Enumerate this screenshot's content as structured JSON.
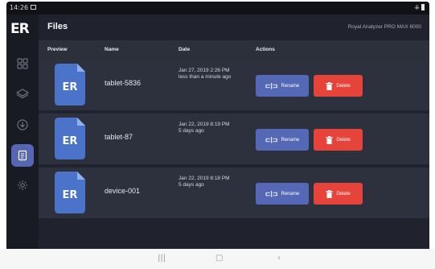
{
  "status_bar": {
    "time": "14:26",
    "icons": [
      "picture-icon",
      "signal-icon",
      "battery-icon"
    ]
  },
  "sidebar": {
    "logo": "ER",
    "items": [
      {
        "name": "dashboard",
        "icon": "grid-icon"
      },
      {
        "name": "layers",
        "icon": "layers-icon"
      },
      {
        "name": "download",
        "icon": "download-icon"
      },
      {
        "name": "files",
        "icon": "files-icon",
        "active": true
      },
      {
        "name": "settings",
        "icon": "gear-icon"
      }
    ]
  },
  "header": {
    "title": "Files",
    "app_name": "Royal Analyzer PRO MAX 6000"
  },
  "table": {
    "columns": [
      "Preview",
      "Name",
      "Date",
      "Actions"
    ],
    "rows": [
      {
        "name": "tablet-5836",
        "date": "Jan 27, 2019 2:26 PM",
        "relative": "less than a minute ago",
        "preview_logo": "ER"
      },
      {
        "name": "tablet-87",
        "date": "Jan 22, 2019 8:19 PM",
        "relative": "5 days ago",
        "preview_logo": "ER"
      },
      {
        "name": "device-001",
        "date": "Jan 22, 2019 8:18 PM",
        "relative": "5 days ago",
        "preview_logo": "ER"
      }
    ],
    "actions": {
      "rename": "Rename",
      "delete": "Delete"
    }
  },
  "colors": {
    "accent": "#5466b4",
    "delete": "#e6433a",
    "background": "#20232d",
    "row": "#2d313d"
  },
  "system_nav": {
    "recents": "|||",
    "home": "▢",
    "back": "‹"
  }
}
